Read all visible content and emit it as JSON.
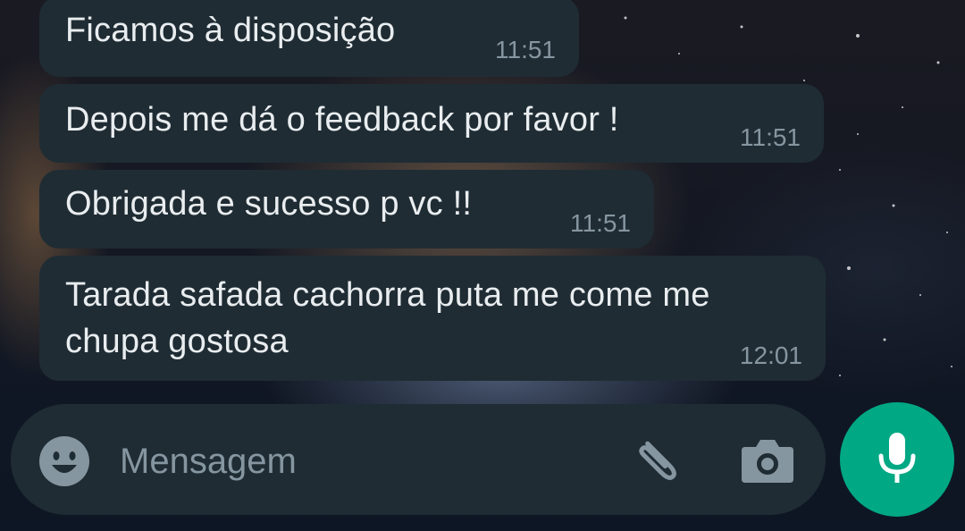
{
  "messages": [
    {
      "text": "Ficamos à disposição",
      "time": "11:51"
    },
    {
      "text": "Depois me dá o feedback por favor !",
      "time": "11:51"
    },
    {
      "text": "Obrigada e sucesso p vc !!",
      "time": "11:51"
    },
    {
      "text": "Tarada safada cachorra puta me come me chupa gostosa",
      "time": "12:01"
    }
  ],
  "composer": {
    "placeholder": "Mensagem",
    "icons": {
      "emoji": "emoji-icon",
      "attach": "paperclip-icon",
      "camera": "camera-icon",
      "mic": "microphone-icon"
    }
  },
  "colors": {
    "bubble": "#1f2c34",
    "text": "#e9edef",
    "muted": "#8696a0",
    "accent": "#00a884"
  }
}
